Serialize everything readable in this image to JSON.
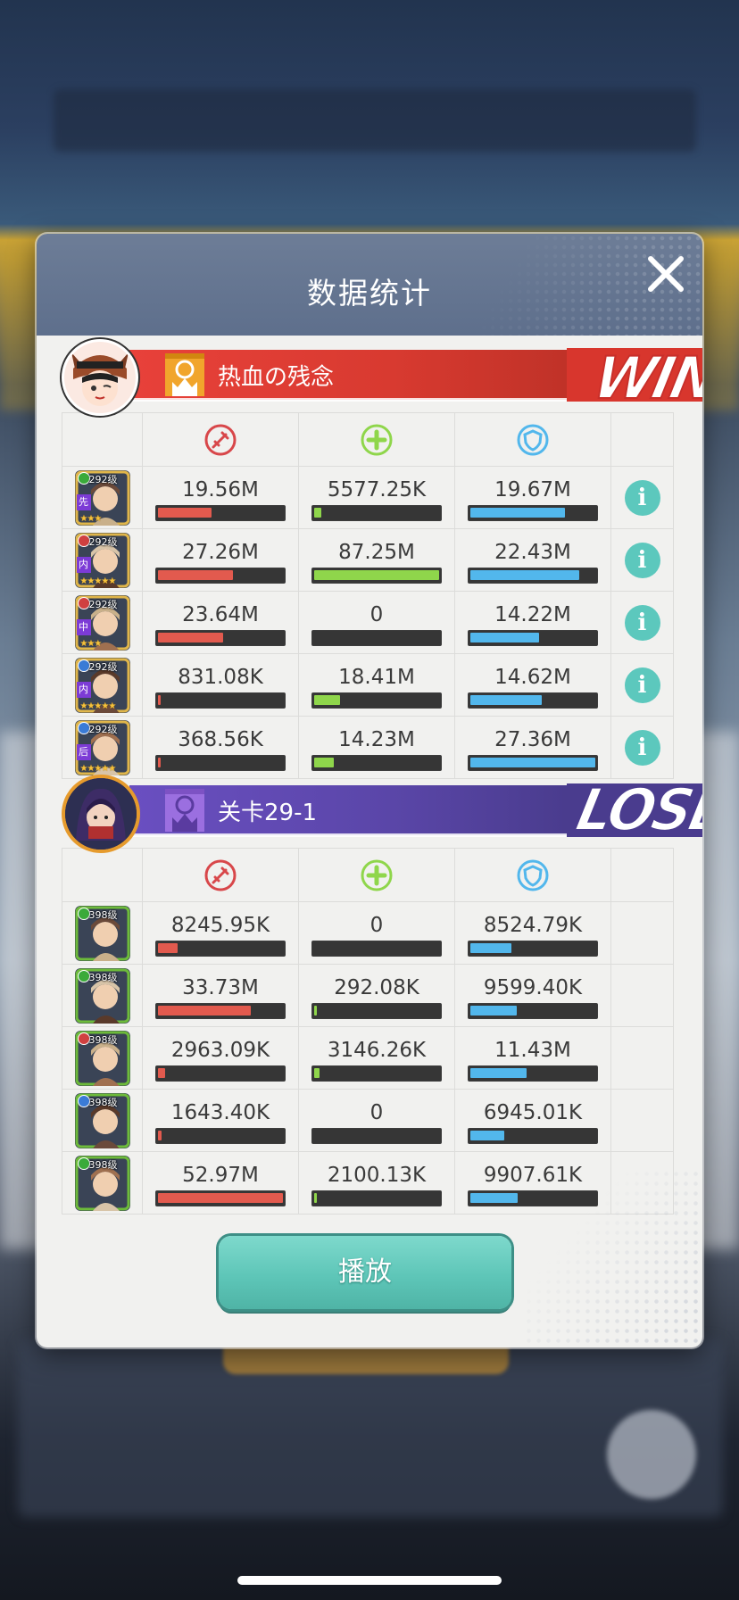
{
  "dialog": {
    "title": "数据统计",
    "play_label": "播放"
  },
  "teams": [
    {
      "name": "热血の残念",
      "result": "WIN",
      "color": "#d8362d",
      "heroes": [
        {
          "level": "292级",
          "position": "先",
          "badge_color": "#3aaa3a",
          "stars": "★★★",
          "damage": "19.56M",
          "damage_pct": 0.43,
          "heal": "5577.25K",
          "heal_pct": 0.06,
          "defense": "19.67M",
          "defense_pct": 0.76
        },
        {
          "level": "292级",
          "position": "内",
          "badge_color": "#d04040",
          "stars": "★★★★★",
          "damage": "27.26M",
          "damage_pct": 0.6,
          "heal": "87.25M",
          "heal_pct": 1.0,
          "defense": "22.43M",
          "defense_pct": 0.87
        },
        {
          "level": "292级",
          "position": "中",
          "badge_color": "#d04040",
          "stars": "★★★",
          "damage": "23.64M",
          "damage_pct": 0.52,
          "heal": "0",
          "heal_pct": 0,
          "defense": "14.22M",
          "defense_pct": 0.55
        },
        {
          "level": "292级",
          "position": "内",
          "badge_color": "#3a7bd6",
          "stars": "★★★★★",
          "damage": "831.08K",
          "damage_pct": 0.02,
          "heal": "18.41M",
          "heal_pct": 0.21,
          "defense": "14.62M",
          "defense_pct": 0.57
        },
        {
          "level": "292级",
          "position": "后",
          "badge_color": "#3a7bd6",
          "stars": "★★★★★",
          "damage": "368.56K",
          "damage_pct": 0.01,
          "heal": "14.23M",
          "heal_pct": 0.16,
          "defense": "27.36M",
          "defense_pct": 1.0
        }
      ]
    },
    {
      "name": "关卡29-1",
      "result": "LOSE",
      "color": "#4a3c8e",
      "heroes": [
        {
          "level": "398级",
          "badge_color": "#3aaa3a",
          "damage": "8245.95K",
          "damage_pct": 0.16,
          "heal": "0",
          "heal_pct": 0,
          "defense": "8524.79K",
          "defense_pct": 0.33
        },
        {
          "level": "398级",
          "badge_color": "#3aaa3a",
          "damage": "33.73M",
          "damage_pct": 0.74,
          "heal": "292.08K",
          "heal_pct": 0.01,
          "defense": "9599.40K",
          "defense_pct": 0.37
        },
        {
          "level": "398级",
          "badge_color": "#d04040",
          "damage": "2963.09K",
          "damage_pct": 0.06,
          "heal": "3146.26K",
          "heal_pct": 0.04,
          "defense": "11.43M",
          "defense_pct": 0.45
        },
        {
          "level": "398级",
          "badge_color": "#3a7bd6",
          "damage": "1643.40K",
          "damage_pct": 0.03,
          "heal": "0",
          "heal_pct": 0,
          "defense": "6945.01K",
          "defense_pct": 0.27
        },
        {
          "level": "398级",
          "badge_color": "#3aaa3a",
          "damage": "52.97M",
          "damage_pct": 1.0,
          "heal": "2100.13K",
          "heal_pct": 0.02,
          "defense": "9907.61K",
          "defense_pct": 0.38
        }
      ]
    }
  ],
  "icons": {
    "damage": "sword-icon",
    "heal": "cross-icon",
    "defense": "shield-icon",
    "info": "info-icon",
    "close": "close-icon"
  },
  "info_glyph": "i",
  "colors": {
    "damage_bar": "#e25a4e",
    "heal_bar": "#8fd64b",
    "defense_bar": "#52b7ec",
    "play_button": "#5ec6b8"
  }
}
